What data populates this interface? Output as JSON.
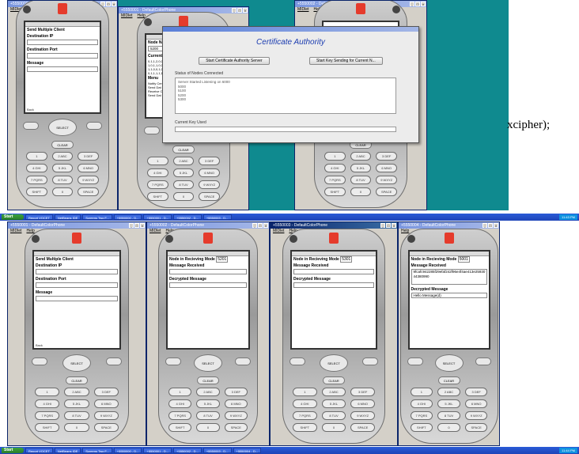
{
  "app": {
    "window_title": "+5550000 - DefaultColorPhone",
    "window_title_b": "+5550001 - DefaultColorPhone",
    "window_title_c": "+5550002 - DefaultColorPhone",
    "window_title_d": "+5550003 - DefaultColorPhone",
    "window_title_e": "+5550004 - DefaultColorPhone",
    "menu": [
      "MIDlet",
      "Help"
    ]
  },
  "dialog": {
    "title": "Certificate Authority",
    "start_button": "Start Certificate Authority Server",
    "keysend_button": "Start Key Sending for Current N...",
    "status_label": "Status of Nodes Connected",
    "status_lines": [
      "Server Started Listening on 6000",
      "5000",
      "5100",
      "5200",
      "5300"
    ],
    "current_key_label": "Current Key Used"
  },
  "phone_send": {
    "heading": "Send Multiple Client",
    "dest_ip_label": "Destination IP",
    "dest_port_label": "Destination Port",
    "message_label": "Message",
    "back": "Back"
  },
  "phone_node": {
    "name_label": "Node Name",
    "name_value": "5200",
    "current_label": "Current Re",
    "lines": [
      "0,1,1,2,0,0,0",
      "1,0,1,1,0,0,0",
      "1,1,0,0,1,0,0",
      "0,1,1,1,1,1,0"
    ],
    "menu_label": "Menu",
    "options": [
      "Notify Cer",
      "Send Dat",
      "Receive C",
      "Send Dat"
    ]
  },
  "phone_recv_a": {
    "mode_label": "Node in Recieving Mode",
    "mode_value": "5201",
    "msg_label": "Message Received",
    "dec_label": "Decrypted Message"
  },
  "phone_recv_b": {
    "mode_label": "Node in Recieving Mode",
    "mode_value": "5301",
    "msg_label": "Message Received",
    "dec_label": "Decrypted Message"
  },
  "phone_recv_c": {
    "mode_label": "Node in Recieving Mode",
    "mode_value": "5001",
    "msg_label": "Message Received",
    "msg_value": "9fcafc942285f29efaf242f96e4f4ae413e2593044380990",
    "dec_label": "Decrypted Message",
    "dec_value": "Hello Message(d)"
  },
  "keypad": {
    "select": "SELECT",
    "clear": "CLEAR",
    "keys": [
      "1",
      "2 ABC",
      "3 DEF",
      "4 GHI",
      "5 JKL",
      "6 MNO",
      "7 PQRS",
      "8 TUV",
      "9 WXYZ",
      "SHIFT",
      "0",
      "SPACE"
    ]
  },
  "taskbar": {
    "start": "Start",
    "items": [
      "Report VOCET",
      "NetBeans IDE",
      "Screens Two F...",
      "+5550000 - D...",
      "+5550001 - D...",
      "+5550002 - D...",
      "+5550003 - D...",
      "+5550004 - D..."
    ],
    "clock": "11:43 PM",
    "clock2": "11:44 PM"
  },
  "snippet_text": "xcipher);",
  "colors": {
    "desktop": "#0f8a8f",
    "title_active": "#0a246a",
    "dialog_heading": "#1a3bb0"
  }
}
